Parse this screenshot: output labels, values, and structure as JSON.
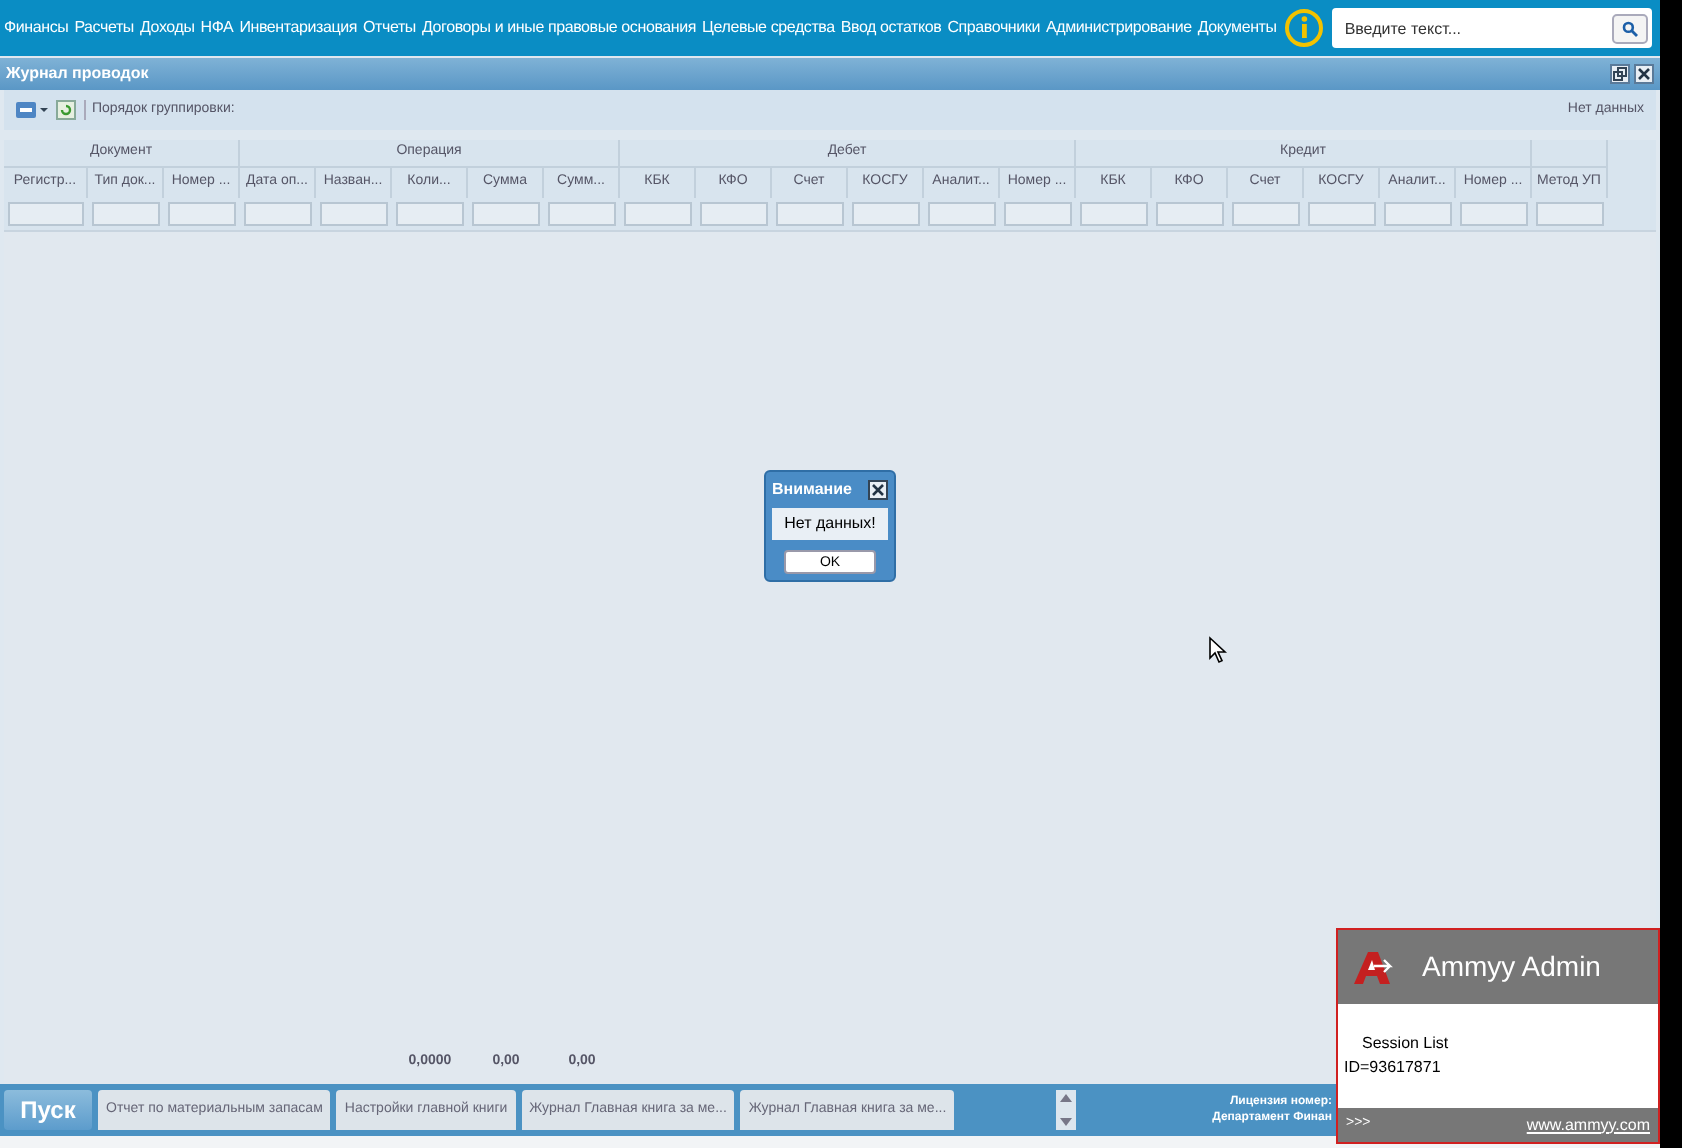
{
  "menu": [
    "Финансы",
    "Расчеты",
    "Доходы",
    "НФА",
    "Инвентаризация",
    "Отчеты",
    "Договоры и иные правовые основания",
    "Целевые средства",
    "Ввод остатков",
    "Справочники",
    "Администрирование",
    "Документы"
  ],
  "search": {
    "placeholder": "Введите текст..."
  },
  "panel": {
    "title": "Журнал проводок"
  },
  "toolbar": {
    "grouping_label": "Порядок группировки:",
    "status": "Нет данных"
  },
  "table": {
    "groups": [
      "Документ",
      "Операция",
      "Дебет",
      "Кредит"
    ],
    "columns": [
      "Регистр...",
      "Тип док...",
      "Номер ...",
      "Дата оп...",
      "Назван...",
      "Коли...",
      "Сумма",
      "Сумм...",
      "КБК",
      "КФО",
      "Счет",
      "КОСГУ",
      "Аналит...",
      "Номер ...",
      "КБК",
      "КФО",
      "Счет",
      "КОСГУ",
      "Аналит...",
      "Номер ...",
      "Метод УП"
    ],
    "totals": [
      "0,0000",
      "0,00",
      "0,00"
    ]
  },
  "dialog": {
    "title": "Внимание",
    "message": "Нет данных!",
    "button": "OK"
  },
  "taskbar": {
    "start": "Пуск",
    "tabs": [
      "Отчет по материальным запасам",
      "Настройки главной книги",
      "Журнал Главная книга за ме...",
      "Журнал Главная книга за ме..."
    ],
    "license_lines": [
      "Лицензия номер:",
      "Департамент Финан"
    ]
  },
  "ammyy": {
    "title": "Ammyy Admin",
    "session_list": "Session List",
    "id": "ID=93617871",
    "more": ">>>",
    "link": "www.ammyy.com"
  }
}
